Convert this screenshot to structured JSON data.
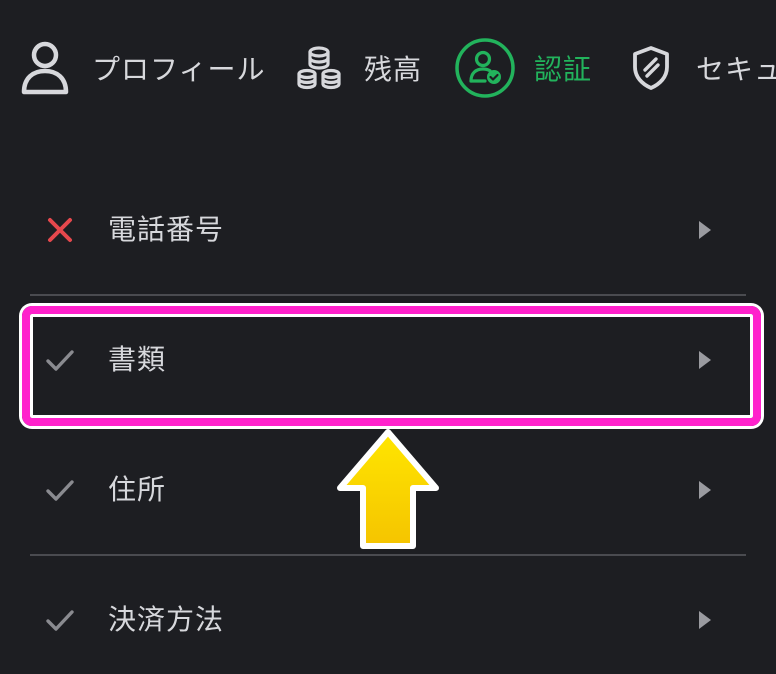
{
  "nav": {
    "items": [
      {
        "label": "プロフィール",
        "icon": "person-icon"
      },
      {
        "label": "残高",
        "icon": "coins-icon"
      },
      {
        "label": "認証",
        "icon": "verified-user-icon",
        "active": true
      },
      {
        "label": "セキュ",
        "icon": "shield-icon"
      }
    ]
  },
  "verification": {
    "items": [
      {
        "label": "電話番号",
        "status": "incomplete",
        "status_icon": "cross-icon"
      },
      {
        "label": "書類",
        "status": "complete",
        "status_icon": "check-icon",
        "highlighted": true
      },
      {
        "label": "住所",
        "status": "complete",
        "status_icon": "check-icon"
      },
      {
        "label": "決済方法",
        "status": "complete",
        "status_icon": "check-icon"
      }
    ]
  },
  "colors": {
    "background": "#1d1e22",
    "text": "#d7d8dc",
    "active": "#22b35c",
    "error": "#e5484d",
    "check": "#8a8b90",
    "chevron": "#9a9ba0",
    "divider": "#4a4b50",
    "highlight": "#ff22cc",
    "arrow": "#ffd400"
  }
}
